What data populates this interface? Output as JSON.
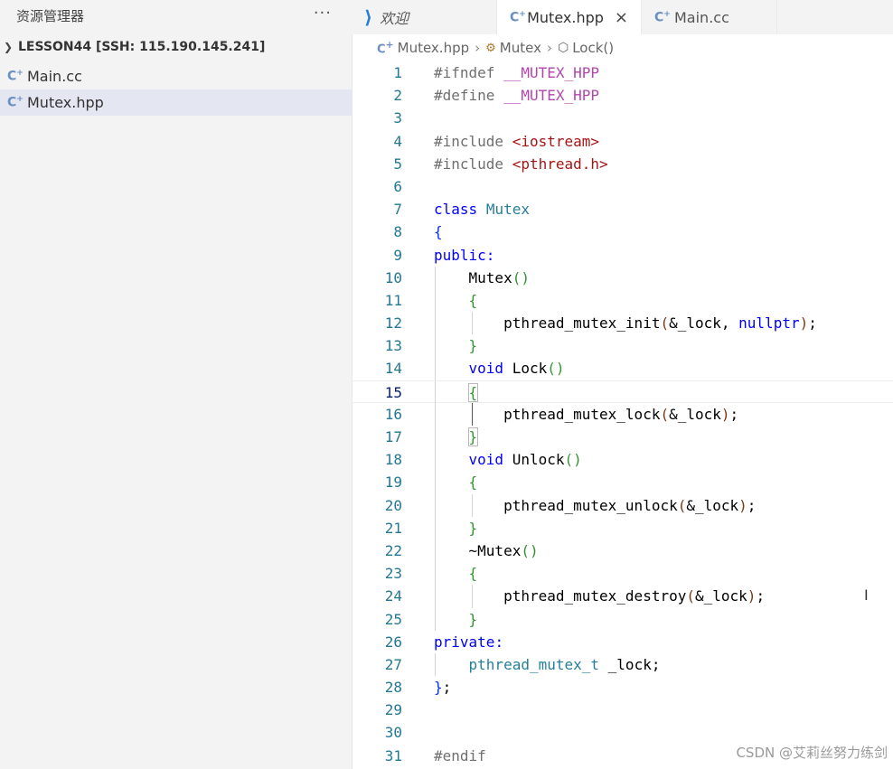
{
  "sidebar": {
    "title": "资源管理器",
    "more": "···",
    "folder": "LESSON44 [SSH: 115.190.145.241]",
    "files": [
      {
        "name": "Main.cc",
        "active": false
      },
      {
        "name": "Mutex.hpp",
        "active": true
      }
    ]
  },
  "tabs": {
    "welcome": "欢迎",
    "active": "Mutex.hpp",
    "close": "×",
    "other": "Main.cc"
  },
  "breadcrumb": {
    "file": "Mutex.hpp",
    "class": "Mutex",
    "method": "Lock()"
  },
  "code": {
    "line_numbers": [
      "1",
      "2",
      "3",
      "4",
      "5",
      "6",
      "7",
      "8",
      "9",
      "10",
      "11",
      "12",
      "13",
      "14",
      "15",
      "16",
      "17",
      "18",
      "19",
      "20",
      "21",
      "22",
      "23",
      "24",
      "25",
      "26",
      "27",
      "28",
      "29",
      "30",
      "31"
    ],
    "current_line": "15"
  },
  "watermark": "CSDN @艾莉丝努力练剑",
  "colors": {
    "keyword": "#0000ff",
    "macro": "#b246ad",
    "string": "#a31515",
    "type": "#267f99",
    "line_number": "#237893",
    "vscode_blue": "#2a7ed2"
  }
}
